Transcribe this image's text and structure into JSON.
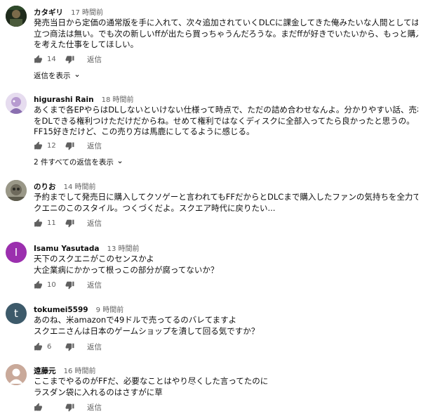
{
  "comments": [
    {
      "author": "カタギリ",
      "time": "17 時間前",
      "lines": [
        "発売当日から定価の通常版を手に入れて、次々追加されていくDLCに課金してきた俺みたいな人間としてはこれほど腹が",
        "立つ商法は無い。でも次の新しいffが出たら買っちゃうんだろうな。まだffが好きでいたいから、もっと購入層の気持ち",
        "を考えた仕事をしてほしい。"
      ],
      "likes": "14",
      "reply_label": "返信",
      "view_replies": "返信を表示"
    },
    {
      "author": "higurashi Rain",
      "time": "18 時間前",
      "lines": [
        "あくまで各EPやらはDLしないといけない仕様って時点で、ただの詰め合わせなんよ。分かりやすい話、売れ残りにDLC",
        "をDLできる権利つけただけだからね。せめて権利ではなくディスクに全部入ってたら良かったと思うの。",
        "FF15好きだけど、この売り方は馬鹿にしてるように感じる。"
      ],
      "likes": "12",
      "reply_label": "返信",
      "view_replies": "2 件すべての返信を表示"
    },
    {
      "author": "のりお",
      "time": "14 時間前",
      "lines": [
        "予約までして発売日に購入してクソゲーと言われてもFFだからとDLCまで購入したファンの気持ちを全力で潰しにくるス",
        "クエニのこのスタイル。つくづくだよ。スクエア時代に戻りたい..."
      ],
      "likes": "11",
      "reply_label": "返信"
    },
    {
      "author": "Isamu Yasutada",
      "time": "13 時間前",
      "avatar_letter": "I",
      "lines": [
        "天下のスクエニがこのセンスかよ",
        "大企業病にかかって根っこの部分が腐ってないか？"
      ],
      "likes": "10",
      "reply_label": "返信"
    },
    {
      "author": "tokumei5599",
      "time": "9 時間前",
      "avatar_letter": "t",
      "lines": [
        "あのね、米amazonで49ドルで売ってるのバレてますよ",
        "スクエニさんは日本のゲームショップを潰して回る気ですか？"
      ],
      "likes": "6",
      "reply_label": "返信"
    },
    {
      "author": "遠藤元",
      "time": "16 時間前",
      "lines": [
        "ここまでやるのがFFだ、必要なことはやり尽くした言ってたのに",
        "ラスダン袋に入れるのはさすがに草"
      ],
      "likes": "",
      "reply_label": "返信"
    }
  ],
  "colors": {
    "avatar_isamu": "#9b2fae",
    "avatar_tokumei": "#3d5a6a",
    "meta_text": "#606060"
  }
}
